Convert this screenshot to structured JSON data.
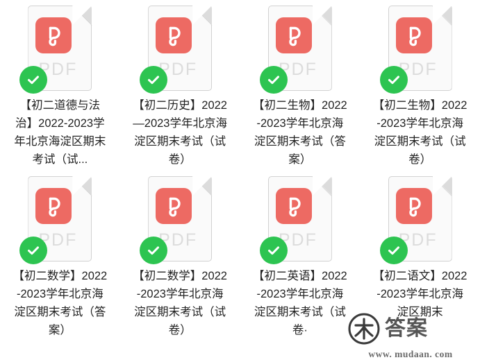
{
  "view": {
    "type": "file-grid",
    "columns": 4,
    "rows": 2,
    "background_color": "#ffffff"
  },
  "icon": {
    "file_type_label": "PDF",
    "badge_color": "#ed6a63",
    "page_color": "#fafafa",
    "page_border_color": "#d2d2d2",
    "pdf_text_color": "#dcdcdc",
    "check_color": "#2dc451",
    "logo_glyph_name": "wps-p-glyph",
    "check_glyph_name": "check-mark"
  },
  "files": [
    {
      "id": 1,
      "name": "【初二道德与法治】2022-2023学年北京海淀区期末考试（试...",
      "selected": true,
      "file_type": "PDF"
    },
    {
      "id": 2,
      "name": "【初二历史】2022—2023学年北京海淀区期末考试（试卷）",
      "selected": true,
      "file_type": "PDF"
    },
    {
      "id": 3,
      "name": "【初二生物】2022-2023学年北京海淀区期末考试（答案）",
      "selected": true,
      "file_type": "PDF"
    },
    {
      "id": 4,
      "name": "【初二生物】2022-2023学年北京海淀区期末考试（试卷）",
      "selected": true,
      "file_type": "PDF"
    },
    {
      "id": 5,
      "name": "【初二数学】2022-2023学年北京海淀区期末考试（答案）",
      "selected": true,
      "file_type": "PDF"
    },
    {
      "id": 6,
      "name": "【初二数学】2022-2023学年北京海淀区期末考试（试卷）",
      "selected": true,
      "file_type": "PDF"
    },
    {
      "id": 7,
      "name": "【初二英语】2022-2023学年北京海淀区期末考试（试卷·",
      "selected": true,
      "file_type": "PDF"
    },
    {
      "id": 8,
      "name": "【初二语文】2022-2023学年北京海淀区期末",
      "selected": true,
      "file_type": "PDF"
    }
  ],
  "watermark": {
    "logo_glyph_name": "mu-circle-logo",
    "text": "答案",
    "url": "www. mudaan. com",
    "color": "#555555"
  }
}
